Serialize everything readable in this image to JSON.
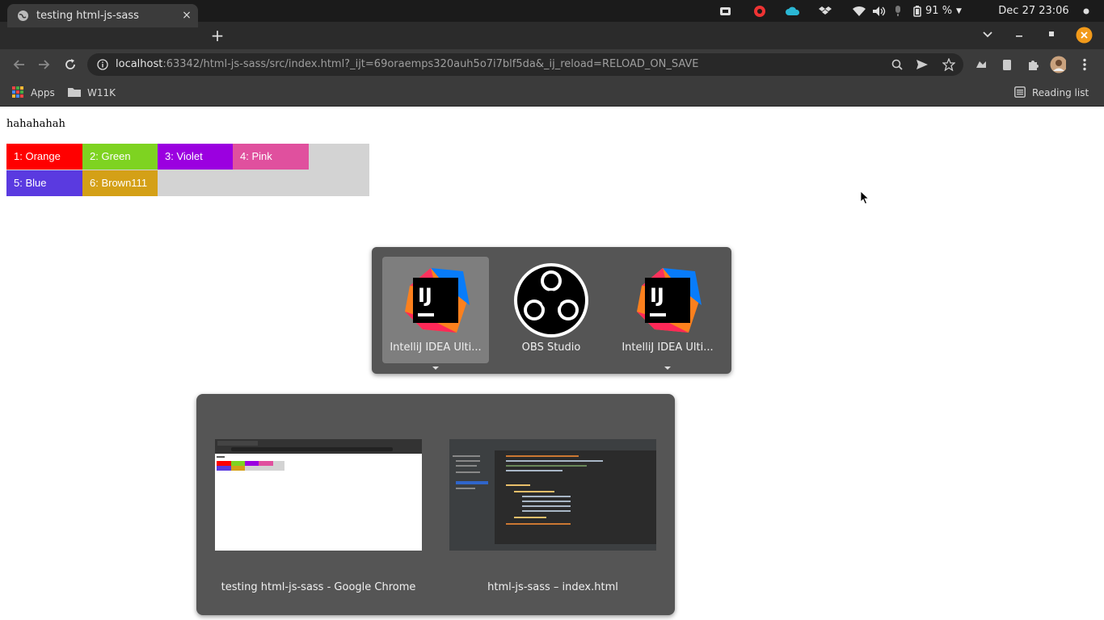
{
  "system_bar": {
    "battery": "91 %",
    "datetime": "Dec 27  23:06"
  },
  "tab": {
    "title": "testing html-js-sass",
    "close": "×"
  },
  "new_tab": "+",
  "address": {
    "host": "localhost",
    "path": ":63342/html-js-sass/src/index.html?_ijt=69oraemps320auh5o7i7blf5da&_ij_reload=RELOAD_ON_SAVE"
  },
  "bookmarks": {
    "apps": "Apps",
    "folder": "W11K",
    "reading_list": "Reading list"
  },
  "page": {
    "text": "hahahahah",
    "cells": [
      {
        "label": "1: Orange",
        "color": "#ff0000"
      },
      {
        "label": "2: Green",
        "color": "#7ed321"
      },
      {
        "label": "3: Violet",
        "color": "#9b00e0"
      },
      {
        "label": "4: Pink",
        "color": "#e0509e"
      },
      {
        "label": "5: Blue",
        "color": "#5a3ae0"
      },
      {
        "label": "6: Brown111",
        "color": "#d4a017"
      }
    ]
  },
  "app_switcher": {
    "apps": [
      {
        "label": "IntelliJ IDEA Ulti...",
        "icon": "intellij-icon",
        "selected": true
      },
      {
        "label": "OBS Studio",
        "icon": "obs-icon",
        "selected": false
      },
      {
        "label": "IntelliJ IDEA Ulti...",
        "icon": "intellij-icon",
        "selected": false
      }
    ]
  },
  "window_switcher": {
    "windows": [
      {
        "label": "testing html-js-sass - Google Chrome"
      },
      {
        "label": "html-js-sass – index.html"
      }
    ]
  }
}
